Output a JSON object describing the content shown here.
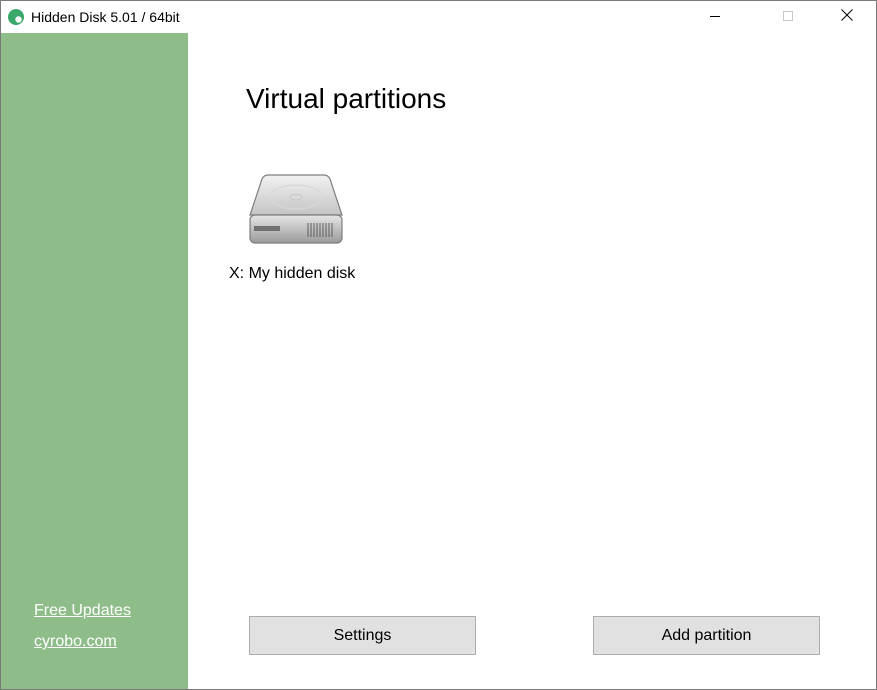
{
  "window": {
    "title": "Hidden Disk 5.01 / 64bit"
  },
  "icons": {
    "app": "app-logo-icon",
    "minimize": "minimize-icon",
    "maximize": "maximize-icon",
    "close": "close-icon",
    "disk": "hard-drive-icon"
  },
  "colors": {
    "sidebar": "#8fbd8a",
    "app_icon": "#3aa86b",
    "button_bg": "#e1e1e1"
  },
  "sidebar": {
    "links": [
      {
        "label": "Free Updates"
      },
      {
        "label": "cyrobo.com"
      }
    ]
  },
  "main": {
    "heading": "Virtual partitions",
    "partitions": [
      {
        "label": "X: My hidden disk"
      }
    ]
  },
  "buttons": {
    "settings": "Settings",
    "add_partition": "Add partition"
  }
}
